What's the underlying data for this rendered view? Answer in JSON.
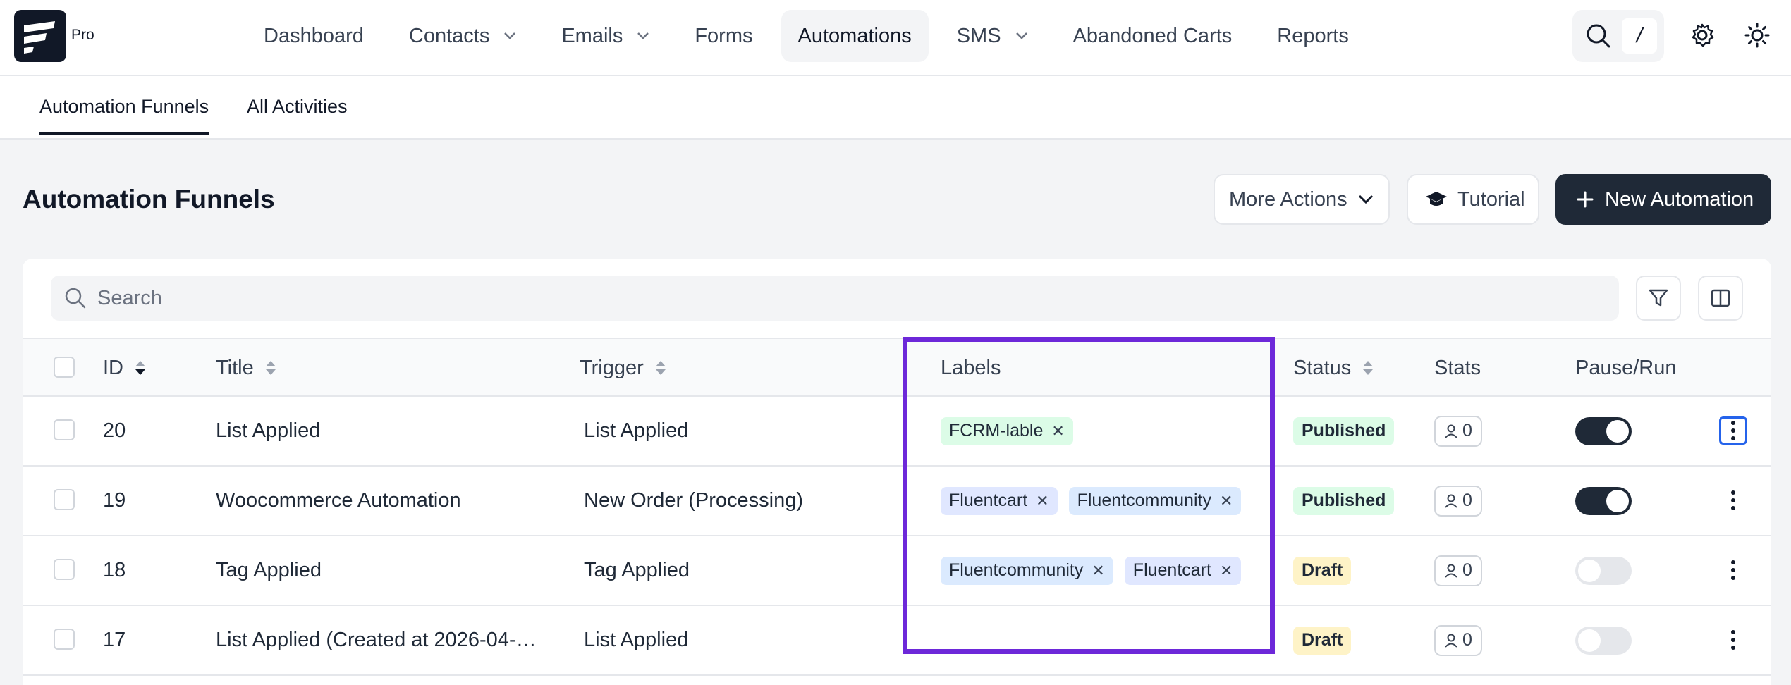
{
  "app": {
    "badge": "Pro"
  },
  "nav": {
    "items": [
      {
        "label": "Dashboard",
        "dropdown": false,
        "active": false
      },
      {
        "label": "Contacts",
        "dropdown": true,
        "active": false
      },
      {
        "label": "Emails",
        "dropdown": true,
        "active": false
      },
      {
        "label": "Forms",
        "dropdown": false,
        "active": false
      },
      {
        "label": "Automations",
        "dropdown": false,
        "active": true
      },
      {
        "label": "SMS",
        "dropdown": true,
        "active": false
      },
      {
        "label": "Abandoned Carts",
        "dropdown": false,
        "active": false
      },
      {
        "label": "Reports",
        "dropdown": false,
        "active": false
      }
    ],
    "search_shortcut": "/"
  },
  "subnav": {
    "tabs": [
      {
        "label": "Automation Funnels",
        "active": true
      },
      {
        "label": "All Activities",
        "active": false
      }
    ]
  },
  "page": {
    "title": "Automation Funnels",
    "more_actions_label": "More Actions",
    "tutorial_label": "Tutorial",
    "new_automation_label": "New Automation"
  },
  "table": {
    "search_placeholder": "Search",
    "columns": {
      "id": "ID",
      "title": "Title",
      "trigger": "Trigger",
      "labels": "Labels",
      "status": "Status",
      "stats": "Stats",
      "pause_run": "Pause/Run"
    },
    "rows": [
      {
        "id": "20",
        "title": "List Applied",
        "trigger": "List Applied",
        "labels": [
          {
            "text": "FCRM-lable",
            "color": "#dcfce7"
          }
        ],
        "status": "Published",
        "stats": "0",
        "running": true
      },
      {
        "id": "19",
        "title": "Woocommerce Automation",
        "trigger": "New Order (Processing)",
        "labels": [
          {
            "text": "Fluentcart",
            "color": "#e0e7ff"
          },
          {
            "text": "Fluentcommunity",
            "color": "#dbeafe"
          }
        ],
        "status": "Published",
        "stats": "0",
        "running": true
      },
      {
        "id": "18",
        "title": "Tag Applied",
        "trigger": "Tag Applied",
        "labels": [
          {
            "text": "Fluentcommunity",
            "color": "#dbeafe"
          },
          {
            "text": "Fluentcart",
            "color": "#e0e7ff"
          }
        ],
        "status": "Draft",
        "stats": "0",
        "running": false
      },
      {
        "id": "17",
        "title": "List Applied (Created at 2026-04-…",
        "trigger": "List Applied",
        "labels": [],
        "status": "Draft",
        "stats": "0",
        "running": false
      }
    ]
  },
  "colors": {
    "accent_dark": "#1f2937",
    "highlight": "#6d28d9",
    "published_bg": "#dcfce7",
    "draft_bg": "#fef3c7"
  }
}
